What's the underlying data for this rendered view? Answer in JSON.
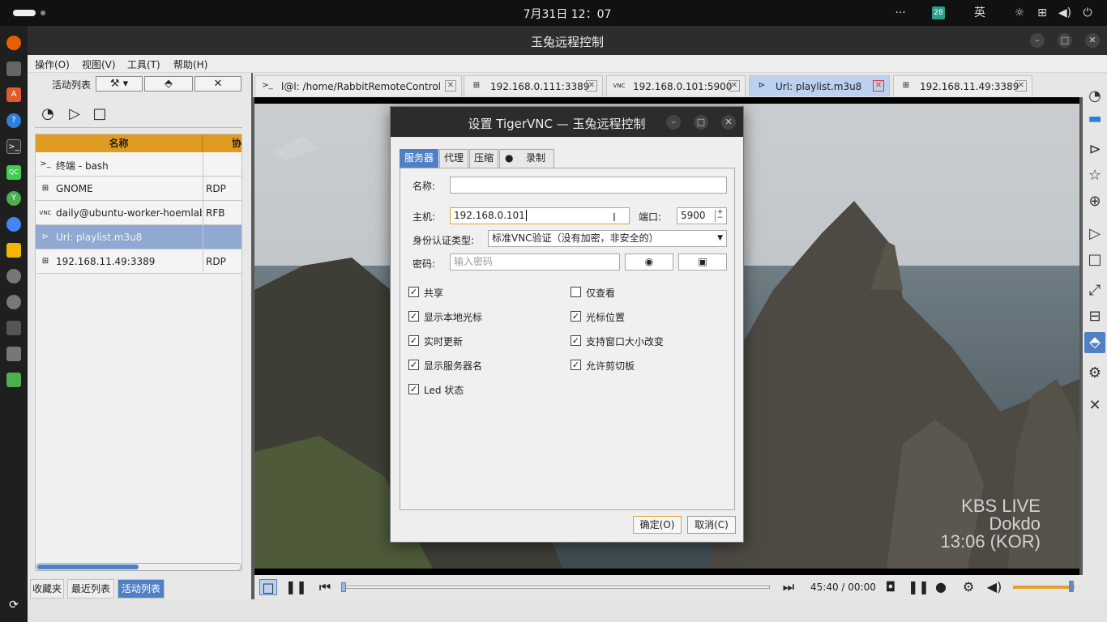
{
  "system": {
    "clock": "7月31日  12：07",
    "more_icon": "···",
    "input_badge": "28",
    "ime": "英"
  },
  "window": {
    "title": "玉兔远程控制"
  },
  "menu": [
    "操作(O)",
    "视图(V)",
    "工具(T)",
    "帮助(H)"
  ],
  "left_panel": {
    "header": "活动列表",
    "columns": [
      "名称",
      "协"
    ],
    "rows": [
      {
        "icon": "terminal-icon",
        "name": "终端 - bash",
        "protocol": ""
      },
      {
        "icon": "windows-icon",
        "name": "GNOME",
        "protocol": "RDP"
      },
      {
        "icon": "vnc-icon",
        "name": "daily@ubuntu-worker-hoemlab",
        "protocol": "RFB"
      },
      {
        "icon": "media-icon",
        "name": "Url: playlist.m3u8",
        "protocol": ""
      },
      {
        "icon": "windows-icon",
        "name": "192.168.11.49:3389",
        "protocol": "RDP"
      }
    ],
    "bottom_tabs": [
      "收藏夹",
      "最近列表",
      "活动列表"
    ],
    "active_bottom_tab": "活动列表"
  },
  "tabs": [
    {
      "icon": "terminal-icon",
      "label": "l@l: /home/RabbitRemoteControl",
      "active": false
    },
    {
      "icon": "windows-icon",
      "label": "192.168.0.111:3389",
      "active": false
    },
    {
      "icon": "vnc-icon",
      "label": "192.168.0.101:5900",
      "active": false
    },
    {
      "icon": "media-icon",
      "label": "Url: playlist.m3u8",
      "active": true
    },
    {
      "icon": "windows-icon",
      "label": "192.168.11.49:3389",
      "active": false
    }
  ],
  "player": {
    "time": "45:40 / 00:00",
    "watermark_line1": "KBS LIVE",
    "watermark_line2": "Dokdo",
    "watermark_line3": "13:06 (KOR)",
    "volume_level": 0.95,
    "seek_position": 0.0
  },
  "dialog": {
    "title": "设置 TigerVNC — 玉兔远程控制",
    "tabs": [
      "服务器",
      "代理",
      "压缩",
      "录制"
    ],
    "active_tab": "服务器",
    "name_label": "名称:",
    "name_value": "",
    "host_label": "主机:",
    "host_value": "192.168.0.101",
    "port_label": "端口:",
    "port_value": "5900",
    "auth_label": "身份认证类型:",
    "auth_value": "标准VNC验证（没有加密，非安全的）",
    "password_label": "密码:",
    "password_placeholder": "输入密码",
    "checkboxes_left": [
      {
        "label": "共享",
        "checked": true
      },
      {
        "label": "显示本地光标",
        "checked": true
      },
      {
        "label": "实时更新",
        "checked": true
      },
      {
        "label": "显示服务器名",
        "checked": true
      },
      {
        "label": "Led 状态",
        "checked": true
      }
    ],
    "checkboxes_right": [
      {
        "label": "仅查看",
        "checked": false
      },
      {
        "label": "光标位置",
        "checked": true
      },
      {
        "label": "支持窗口大小改变",
        "checked": true
      },
      {
        "label": "允许剪切板",
        "checked": true
      }
    ],
    "ok_label": "确定(O)",
    "cancel_label": "取消(C)"
  },
  "colors": {
    "accent": "#4f80c6",
    "header_orange": "#e09c22",
    "focus_border": "#e0a32c"
  }
}
